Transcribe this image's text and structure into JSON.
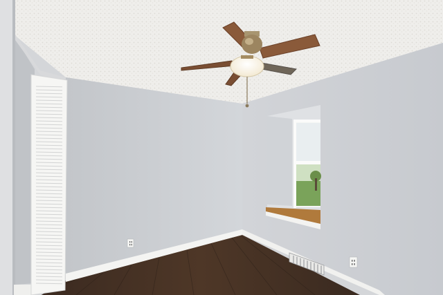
{
  "scene": {
    "description_label": "",
    "colors": {
      "ceiling": "#f0efec",
      "ceiling_shade": "#e2e1dd",
      "back_wall": "#cfd2d6",
      "right_wall": "#d6d8dc",
      "left_wall": "#c6c9cd",
      "floor_dark": "#3a2a20",
      "floor_light": "#5a4332",
      "baseboard": "#f4f4f2",
      "closet_door": "#f5f5f3",
      "fan_blade": "#8a5a3a",
      "fan_metal": "#9c8560",
      "window_sill": "#b07a3c",
      "window_view": "#cfe0c2",
      "window_grass": "#7aa35a"
    },
    "icons": [
      "ceiling-fan-icon",
      "electrical-outlet-icon",
      "floor-vent-icon",
      "louvered-door-icon",
      "window-icon"
    ]
  }
}
